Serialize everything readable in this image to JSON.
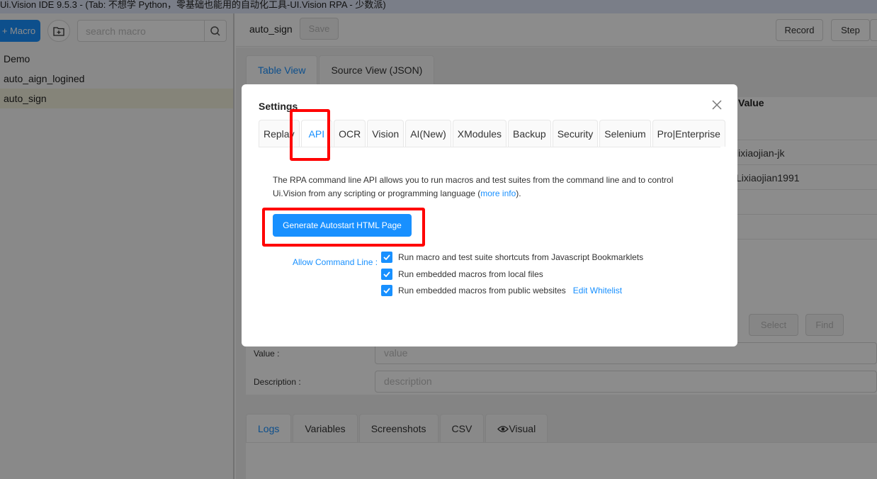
{
  "window": {
    "title": "Ui.Vision IDE 9.5.3 - (Tab: 不想学 Python，零基础也能用的自动化工具-UI.Vision RPA - 少数派)"
  },
  "sidebar": {
    "new_macro_label": "+ Macro",
    "search": {
      "placeholder": "search macro",
      "value": ""
    },
    "macros": [
      {
        "label": "Demo"
      },
      {
        "label": "auto_aign_logined"
      },
      {
        "label": "auto_sign",
        "selected": true
      }
    ]
  },
  "editor": {
    "macro_name": "auto_sign",
    "save_label": "Save",
    "record_label": "Record",
    "step_label": "Step",
    "view_tabs": [
      {
        "label": "Table View",
        "active": true
      },
      {
        "label": "Source View (JSON)"
      }
    ],
    "table": {
      "value_header": "Value",
      "values": [
        "lixiaojian-jk",
        "Lixiaojian1991"
      ]
    },
    "select_label": "Select",
    "find_label": "Find",
    "value_field": {
      "label": "Value",
      "placeholder": "value"
    },
    "description_field": {
      "label": "Description",
      "placeholder": "description"
    },
    "bottom_tabs": [
      {
        "label": "Logs",
        "active": true
      },
      {
        "label": "Variables"
      },
      {
        "label": "Screenshots"
      },
      {
        "label": "CSV"
      },
      {
        "label": "Visual"
      }
    ]
  },
  "settings": {
    "title": "Settings",
    "tabs": [
      {
        "label": "Replay"
      },
      {
        "label": "API",
        "active": true
      },
      {
        "label": "OCR"
      },
      {
        "label": "Vision"
      },
      {
        "label": "AI(New)"
      },
      {
        "label": "XModules"
      },
      {
        "label": "Backup"
      },
      {
        "label": "Security"
      },
      {
        "label": "Selenium"
      },
      {
        "label": "Pro|Enterprise"
      }
    ],
    "api": {
      "description_part1": "The RPA command line API allows you to run macros and test suites from the command line and to control Ui.Vision from any scripting or programming language (",
      "more_info": "more info",
      "description_part2": ").",
      "generate_button": "Generate Autostart HTML Page",
      "allow_label": "Allow Command Line",
      "options": [
        {
          "label": "Run macro and test suite shortcuts from Javascript Bookmarklets",
          "checked": true
        },
        {
          "label": "Run embedded macros from local files",
          "checked": true
        },
        {
          "label": "Run embedded macros from public websites",
          "checked": true
        }
      ],
      "edit_whitelist": "Edit Whitelist"
    }
  },
  "colors": {
    "accent": "#1890ff",
    "highlight": "#ff0000",
    "selected_row": "#f2f1dc"
  }
}
